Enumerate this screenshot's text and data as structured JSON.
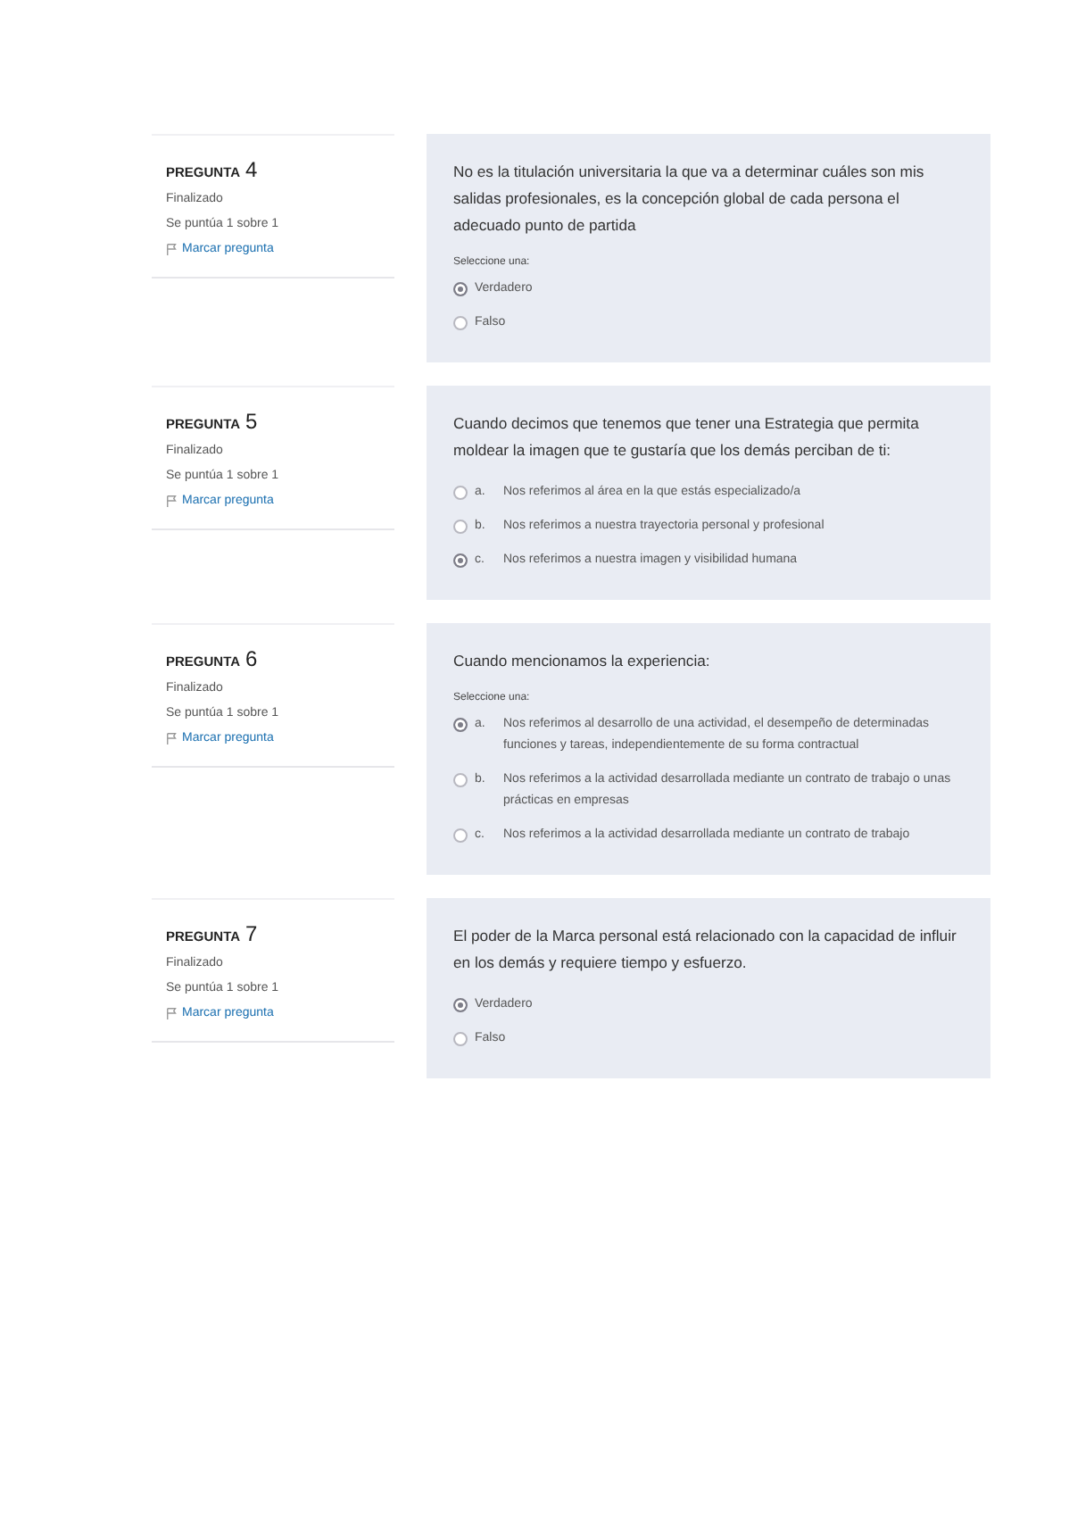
{
  "questions": [
    {
      "label": "PREGUNTA",
      "number": "4",
      "status": "Finalizado",
      "score": "Se puntúa 1 sobre 1",
      "flag": "Marcar pregunta",
      "text": "No es la titulación universitaria la que va a determinar cuáles son mis salidas profesionales, es la concepción global de cada persona el adecuado punto de partida",
      "prompt": "Seleccione una:",
      "options": [
        {
          "text": "Verdadero",
          "selected": true
        },
        {
          "text": "Falso",
          "selected": false
        }
      ]
    },
    {
      "label": "PREGUNTA",
      "number": "5",
      "status": "Finalizado",
      "score": "Se puntúa 1 sobre 1",
      "flag": "Marcar pregunta",
      "text": "Cuando decimos que tenemos que tener una Estrategia que permita moldear la imagen que te gustaría que los demás perciban de ti:",
      "options": [
        {
          "letter": "a.",
          "text": "Nos referimos al área en la que estás especializado/a",
          "selected": false
        },
        {
          "letter": "b.",
          "text": "Nos referimos a nuestra trayectoria personal y profesional",
          "selected": false
        },
        {
          "letter": "c.",
          "text": "Nos referimos a nuestra imagen y visibilidad humana",
          "selected": true
        }
      ]
    },
    {
      "label": "PREGUNTA",
      "number": "6",
      "status": "Finalizado",
      "score": "Se puntúa 1 sobre 1",
      "flag": "Marcar pregunta",
      "text": "Cuando mencionamos la experiencia:",
      "prompt": "Seleccione una:",
      "options": [
        {
          "letter": "a.",
          "text": "Nos referimos al desarrollo de una actividad, el desempeño de determinadas funciones y tareas, independientemente de su forma contractual",
          "selected": true
        },
        {
          "letter": "b.",
          "text": "Nos referimos a la actividad desarrollada mediante un contrato de trabajo o unas prácticas en empresas",
          "selected": false
        },
        {
          "letter": "c.",
          "text": "Nos referimos a la actividad desarrollada mediante un contrato de trabajo",
          "selected": false
        }
      ]
    },
    {
      "label": "PREGUNTA",
      "number": "7",
      "status": "Finalizado",
      "score": "Se puntúa 1 sobre 1",
      "flag": "Marcar pregunta",
      "text": "El poder de la Marca personal está relacionado con la capacidad de influir en los demás y requiere tiempo y esfuerzo.",
      "options": [
        {
          "text": "Verdadero",
          "selected": true
        },
        {
          "text": "Falso",
          "selected": false
        }
      ]
    }
  ]
}
